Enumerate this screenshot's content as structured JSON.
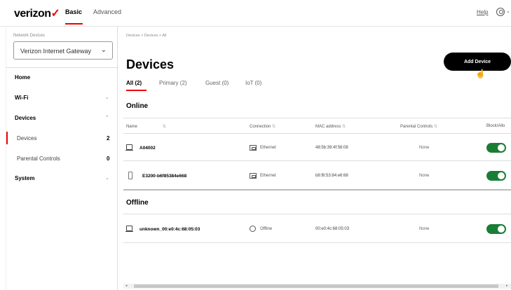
{
  "header": {
    "logo": "verizon",
    "logo_mark": "✓",
    "nav": [
      "Basic",
      "Advanced"
    ],
    "help": "Help"
  },
  "sidebar": {
    "network_devices_label": "Network Devices",
    "selected_device": "Verizon Internet Gateway",
    "items": [
      {
        "label": "Home"
      },
      {
        "label": "Wi-Fi"
      },
      {
        "label": "Devices"
      },
      {
        "label": "Devices",
        "count": "2"
      },
      {
        "label": "Parental Controls",
        "count": "0"
      },
      {
        "label": "System"
      }
    ]
  },
  "main": {
    "breadcrumb": "Devices  >  Devices  >  All",
    "title": "Devices",
    "add_button": "Add Device",
    "tabs": [
      "All (2)",
      "Primary (2)",
      "Guest (0)",
      "IoT (0)"
    ],
    "online_heading": "Online",
    "offline_heading": "Offline",
    "columns": [
      "Name",
      "Connection",
      "MAC address",
      "Parental Controls",
      "Block/Allo"
    ],
    "online_rows": [
      {
        "name": "A04002",
        "connection": "Ethernet",
        "mac": "48:5b:39:4f:56:08",
        "parental": "None",
        "allowed": true
      },
      {
        "name": "E3200-b6f85384e668",
        "connection": "Ethernet",
        "mac": "b8:f8:53:84:e6:68",
        "parental": "None",
        "allowed": true
      }
    ],
    "offline_rows": [
      {
        "name": "unknown_00:e0:4c:68:05:03",
        "connection": "Offline",
        "mac": "00:e0:4c:68:05:03",
        "parental": "None",
        "allowed": true
      }
    ]
  },
  "colors": {
    "accent": "#e00000",
    "toggle_on": "#1a7d36"
  }
}
